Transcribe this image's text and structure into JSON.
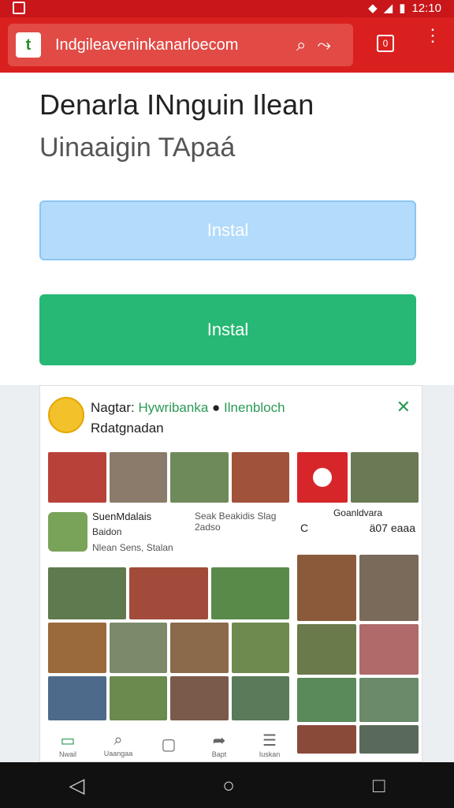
{
  "statusbar": {
    "time": "12:10"
  },
  "browser": {
    "url": "Indgileaveninkanarloecom",
    "tab_count": "0"
  },
  "page": {
    "title": "Denarla INnguin Ilean",
    "subtitle": "Uinaaigin TApaá",
    "install_label_light": "Instal",
    "install_label_green": "Instal"
  },
  "preview": {
    "card_title_a": "Nagtar: ",
    "card_title_b": "Hywribanka",
    "card_title_c": "Ilnenbloch",
    "card_subtitle": "Rdatgnadan",
    "small_card": {
      "title": "SuenMdalais",
      "right_text": "Seak Beakidis Slag 2adso",
      "line2": "Baidon",
      "line3": "Nlean Sens, Stalan"
    },
    "right_panel": {
      "title": "Goanldvara",
      "action_left": "C",
      "action_right": "ä07 eaaa"
    },
    "bottom_nav": [
      "Nwail",
      "Uaangaa",
      "",
      "Bapt",
      "Iuskan"
    ]
  },
  "colors": {
    "toolbar": "#d9201f",
    "install_light": "#b3dbfb",
    "install_green": "#26b874"
  }
}
